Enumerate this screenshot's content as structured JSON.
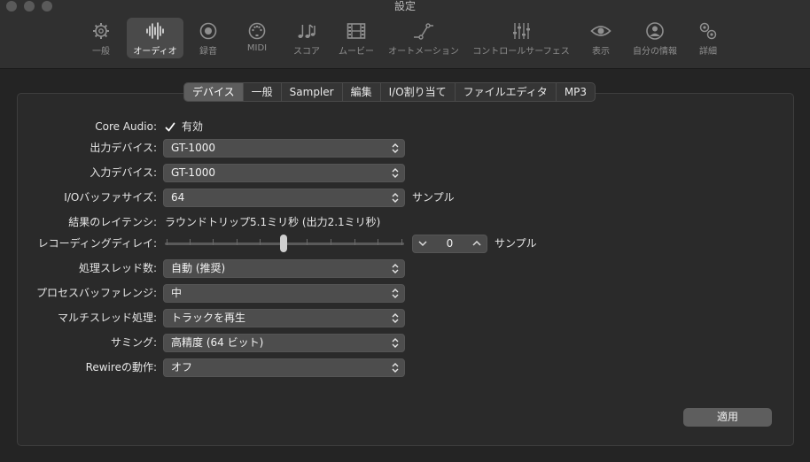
{
  "window": {
    "title": "設定"
  },
  "toolbar": {
    "items": [
      {
        "label": "一般",
        "icon": "gear-icon"
      },
      {
        "label": "オーディオ",
        "icon": "waveform-icon"
      },
      {
        "label": "録音",
        "icon": "record-icon"
      },
      {
        "label": "MIDI",
        "icon": "midi-icon"
      },
      {
        "label": "スコア",
        "icon": "score-icon"
      },
      {
        "label": "ムービー",
        "icon": "film-icon"
      },
      {
        "label": "オートメーション",
        "icon": "automation-icon"
      },
      {
        "label": "コントロールサーフェス",
        "icon": "faders-icon"
      },
      {
        "label": "表示",
        "icon": "eye-icon"
      },
      {
        "label": "自分の情報",
        "icon": "person-icon"
      },
      {
        "label": "詳細",
        "icon": "gears-icon"
      }
    ]
  },
  "tabs": [
    "デバイス",
    "一般",
    "Sampler",
    "編集",
    "I/O割り当て",
    "ファイルエディタ",
    "MP3"
  ],
  "form": {
    "core_audio": {
      "label": "Core Audio:",
      "checkbox_label": "有効",
      "checked": true
    },
    "output_device": {
      "label": "出力デバイス:",
      "value": "GT-1000"
    },
    "input_device": {
      "label": "入力デバイス:",
      "value": "GT-1000"
    },
    "io_buffer": {
      "label": "I/Oバッファサイズ:",
      "value": "64",
      "unit": "サンプル"
    },
    "latency": {
      "label": "結果のレイテンシ:",
      "value": "ラウンドトリップ5.1ミリ秒 (出力2.1ミリ秒)"
    },
    "recording_delay": {
      "label": "レコーディングディレイ:",
      "value": "0",
      "unit": "サンプル"
    },
    "threads": {
      "label": "処理スレッド数:",
      "value": "自動 (推奨)"
    },
    "buffer_range": {
      "label": "プロセスバッファレンジ:",
      "value": "中"
    },
    "multithread": {
      "label": "マルチスレッド処理:",
      "value": "トラックを再生"
    },
    "summing": {
      "label": "サミング:",
      "value": "高精度 (64 ビット)"
    },
    "rewire": {
      "label": "Rewireの動作:",
      "value": "オフ"
    }
  },
  "apply_label": "適用",
  "colors": {
    "accent": "#ffffff",
    "panel": "#2a2a2a",
    "toolbar": "#303030"
  }
}
